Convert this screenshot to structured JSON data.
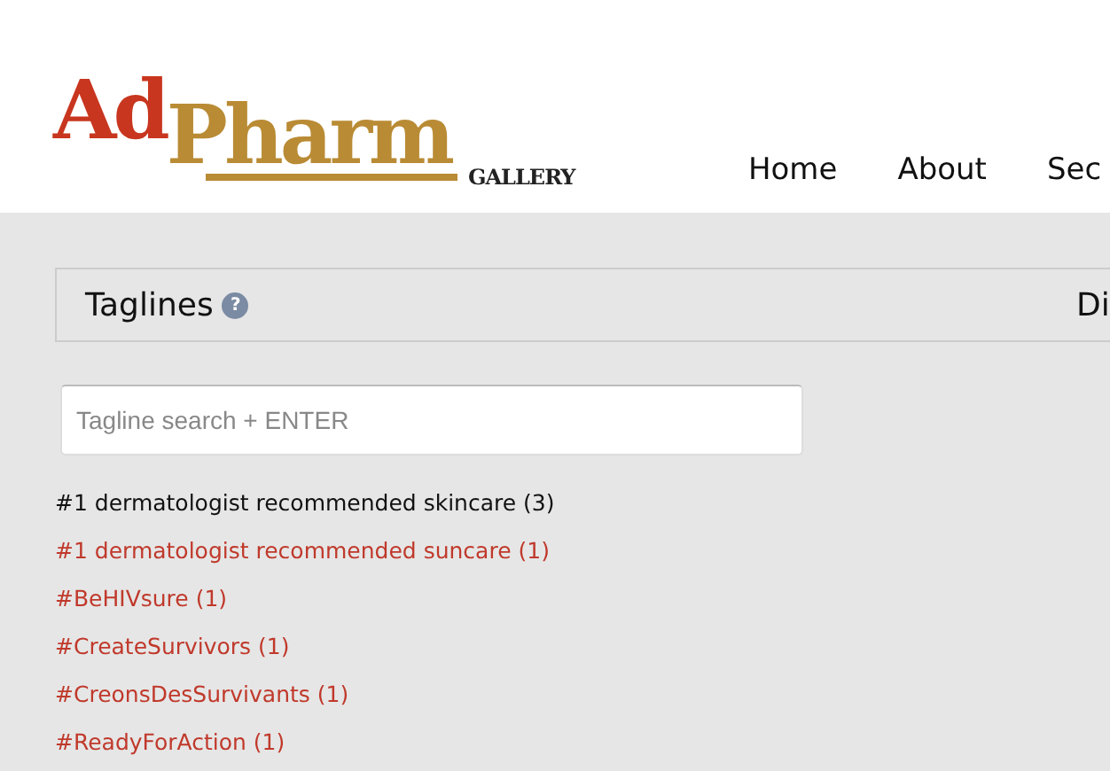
{
  "logo": {
    "part_1": "Ad",
    "part_2": "Pharm",
    "subtitle": "GALLERY"
  },
  "nav": [
    {
      "label": "Home"
    },
    {
      "label": "About"
    },
    {
      "label": "Sec"
    }
  ],
  "panel": {
    "title": "Taglines",
    "help": "?",
    "column_2": "Di"
  },
  "search": {
    "placeholder": "Tagline search + ENTER"
  },
  "taglines": [
    {
      "label": "#1 dermatologist recommended skincare (3)",
      "hovered": true
    },
    {
      "label": "#1 dermatologist recommended suncare (1)",
      "hovered": false
    },
    {
      "label": "#BeHIVsure (1)",
      "hovered": false
    },
    {
      "label": "#CreateSurvivors (1)",
      "hovered": false
    },
    {
      "label": "#CreonsDesSurvivants (1)",
      "hovered": false
    },
    {
      "label": "#ReadyForAction (1)",
      "hovered": false
    }
  ]
}
